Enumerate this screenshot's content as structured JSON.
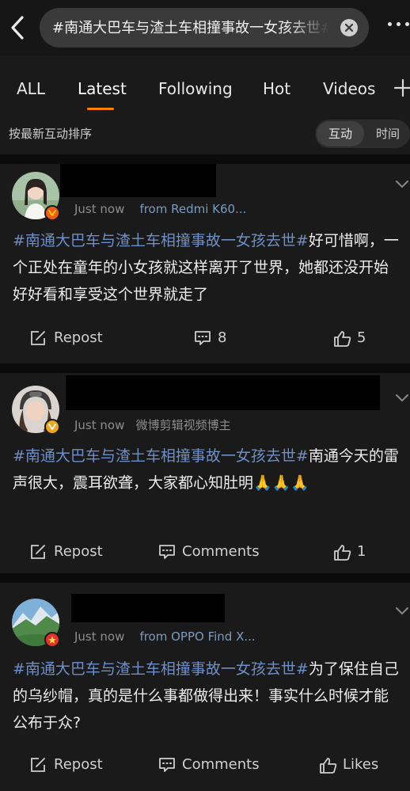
{
  "search": {
    "query": "#南通大巴车与渣土车相撞事故一女孩去世#"
  },
  "tabs": [
    "ALL",
    "Latest",
    "Following",
    "Hot",
    "Videos"
  ],
  "sort": {
    "label": "按最新互动排序",
    "options": [
      "互动",
      "时间"
    ]
  },
  "colors": {
    "accent": "#ff8200",
    "topic": "#6d8fc8",
    "source": "#7a9bc0"
  },
  "posts": [
    {
      "time": "Just now",
      "source": "from Redmi K60...",
      "hashtag": "#南通大巴车与渣土车相撞事故一女孩去世#",
      "text": "好可惜啊，一个正处在童年的小女孩就这样离开了世界，她都还没开始好好看和享受这个世界就走了",
      "repost": "Repost",
      "comments": "8",
      "likes": "5"
    },
    {
      "time": "Just now",
      "source": "微博剪辑视频博主",
      "hashtag": "#南通大巴车与渣土车相撞事故一女孩去世#",
      "text": "南通今天的雷声很大，震耳欲聋，大家都心知肚明🙏🙏🙏",
      "repost": "Repost",
      "comments": "Comments",
      "likes": "1"
    },
    {
      "time": "Just now",
      "source": "from OPPO Find X...",
      "hashtag": "#南通大巴车与渣土车相撞事故一女孩去世#",
      "text": "为了保住自己的乌纱帽，真的是什么事都做得出来！事实什么时候才能公布于众?",
      "repost": "Repost",
      "comments": "Comments",
      "likes": "Likes"
    }
  ]
}
